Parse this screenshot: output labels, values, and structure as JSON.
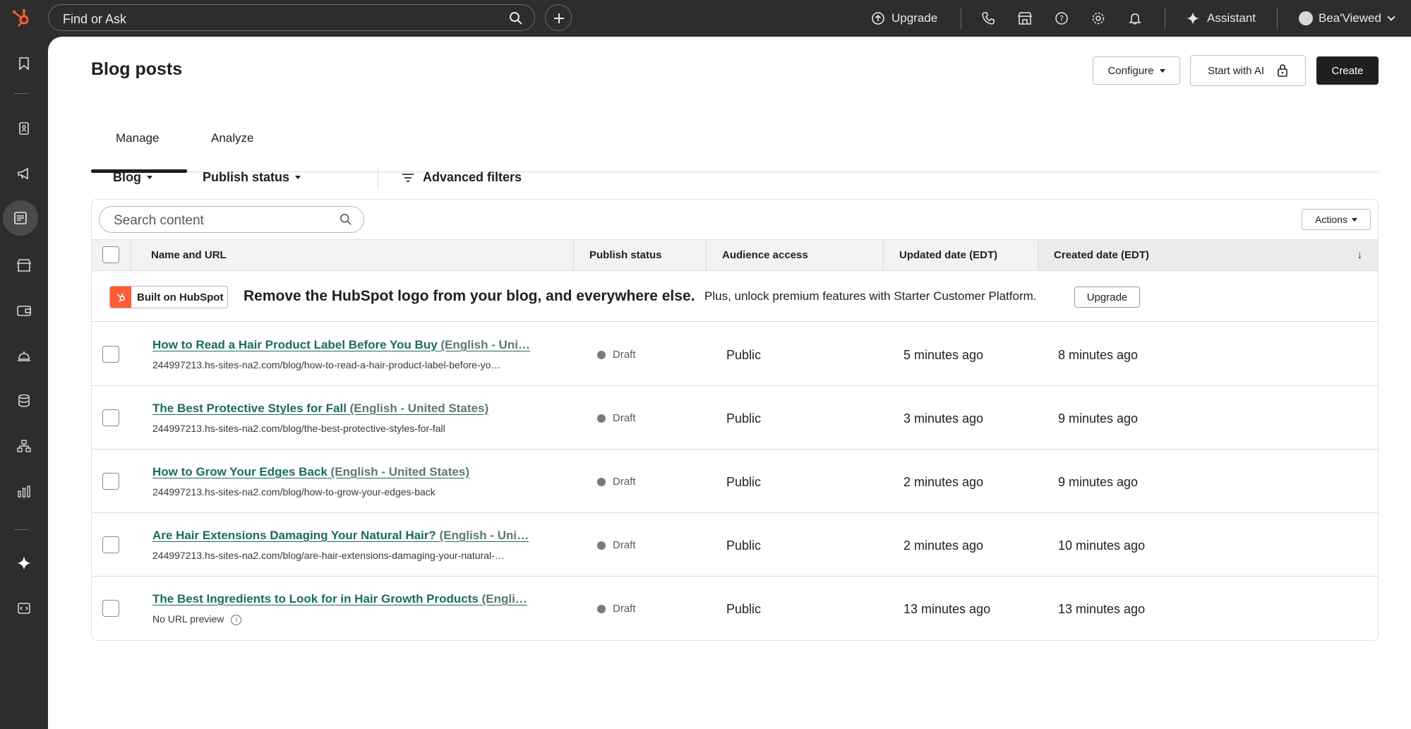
{
  "topbar": {
    "search_placeholder": "Find or Ask",
    "upgrade_label": "Upgrade",
    "assistant_label": "Assistant",
    "user_name": "Bea'Viewed"
  },
  "page": {
    "title": "Blog posts",
    "configure_label": "Configure",
    "start_ai_label": "Start with AI",
    "create_label": "Create"
  },
  "tabs": [
    {
      "label": "Manage"
    },
    {
      "label": "Analyze"
    }
  ],
  "filters": {
    "blog_label": "Blog",
    "publish_status_label": "Publish status",
    "advanced_filters_label": "Advanced filters"
  },
  "table": {
    "search_placeholder": "Search content",
    "actions_label": "Actions",
    "columns": [
      "Name and URL",
      "Publish status",
      "Audience access",
      "Updated date (EDT)",
      "Created date (EDT)"
    ],
    "sort_arrow": "↓",
    "promo": {
      "badge": "Built on HubSpot",
      "title": "Remove the HubSpot logo from your blog, and everywhere else.",
      "subtitle": "Plus, unlock premium features with Starter Customer Platform.",
      "button": "Upgrade"
    },
    "rows": [
      {
        "title": "How to Read a Hair Product Label Before You Buy",
        "lang": " (English - Uni…",
        "url": "244997213.hs-sites-na2.com/blog/how-to-read-a-hair-product-label-before-yo…",
        "status": "Draft",
        "audience": "Public",
        "updated": "5 minutes ago",
        "created": "8 minutes ago"
      },
      {
        "title": "The Best Protective Styles for Fall",
        "lang": " (English - United States)",
        "url": "244997213.hs-sites-na2.com/blog/the-best-protective-styles-for-fall",
        "status": "Draft",
        "audience": "Public",
        "updated": "3 minutes ago",
        "created": "9 minutes ago"
      },
      {
        "title": "How to Grow Your Edges Back",
        "lang": " (English - United States)",
        "url": "244997213.hs-sites-na2.com/blog/how-to-grow-your-edges-back",
        "status": "Draft",
        "audience": "Public",
        "updated": "2 minutes ago",
        "created": "9 minutes ago"
      },
      {
        "title": "Are Hair Extensions Damaging Your Natural Hair?",
        "lang": " (English - Uni…",
        "url": "244997213.hs-sites-na2.com/blog/are-hair-extensions-damaging-your-natural-…",
        "status": "Draft",
        "audience": "Public",
        "updated": "2 minutes ago",
        "created": "10 minutes ago"
      },
      {
        "title": "The Best Ingredients to Look for in Hair Growth Products",
        "lang": " (Engli…",
        "url": "No URL preview",
        "status": "Draft",
        "audience": "Public",
        "updated": "13 minutes ago",
        "created": "13 minutes ago"
      }
    ]
  },
  "colors": {
    "topbar_bg": "#2d2d2d",
    "accent_orange": "#ff5c35",
    "link_teal": "#1b6b62"
  }
}
